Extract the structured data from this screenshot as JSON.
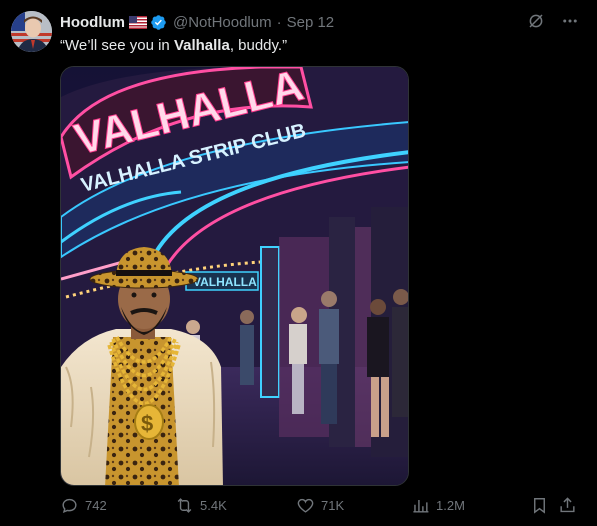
{
  "author": {
    "name": "Hoodlum",
    "handle": "@NotHoodlum",
    "separator": "·",
    "date": "Sep 12",
    "flag_icon": "us-flag-icon",
    "verified_icon": "verified-badge-icon"
  },
  "tweet": {
    "text_pre": "“We’ll see you in ",
    "text_bold": "Valhalla",
    "text_post": ", buddy.”"
  },
  "media": {
    "sign_main": "VALHALLA",
    "sign_sub": "VALHALLA STRIP CLUB",
    "sign_small": "VALHALLA",
    "chain_pendant": "$"
  },
  "actions": {
    "replies": "742",
    "reposts": "5.4K",
    "likes": "71K",
    "views": "1.2M"
  },
  "colors": {
    "background": "#000000",
    "text": "#e7e9ea",
    "muted": "#71767b",
    "verified": "#1d9bf0"
  }
}
